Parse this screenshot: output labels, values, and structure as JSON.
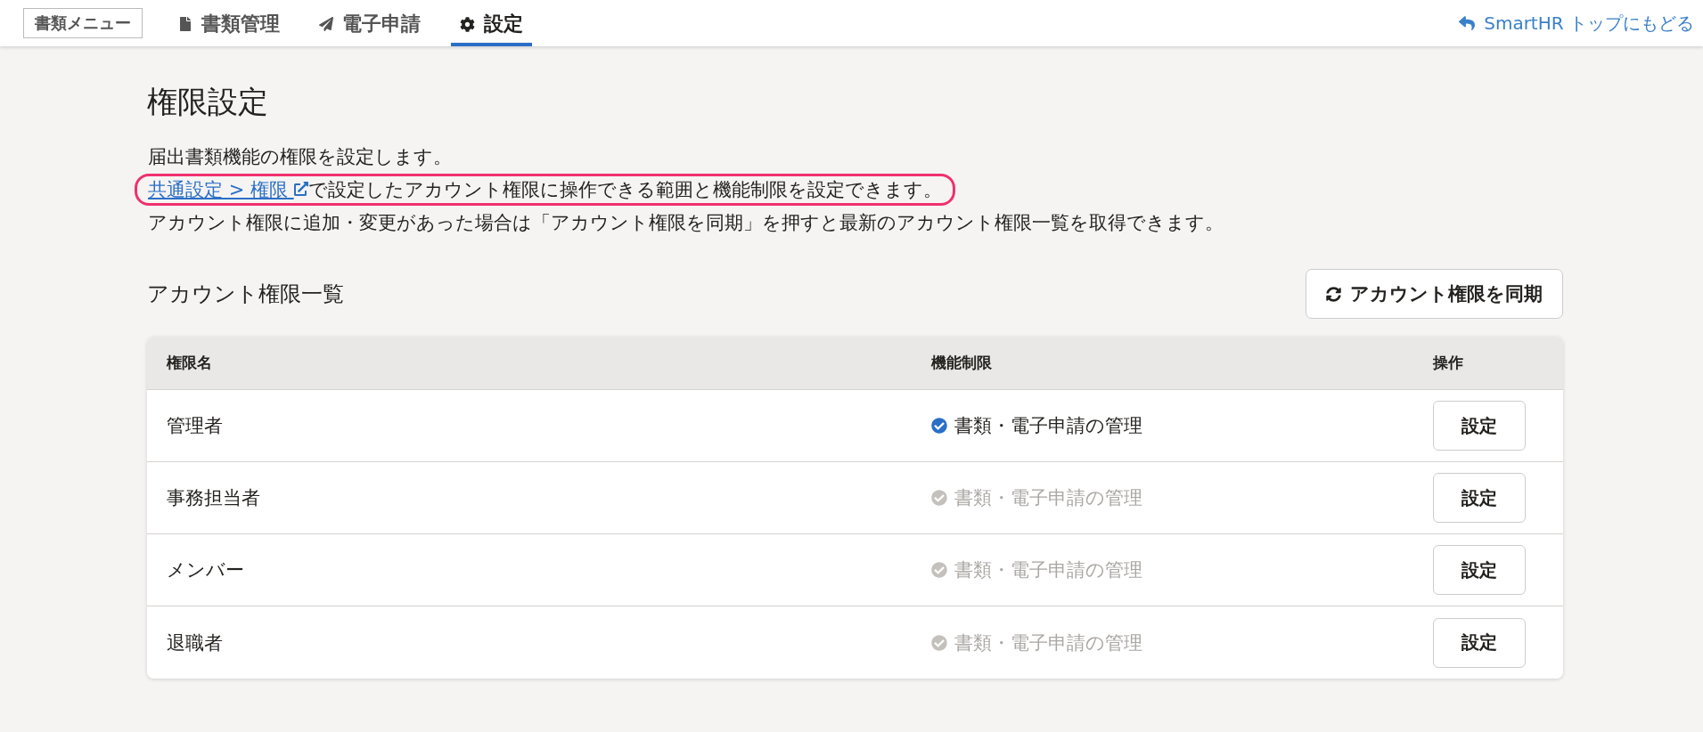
{
  "header": {
    "menu_label": "書類メニュー",
    "tabs": [
      {
        "label": "書類管理",
        "kind": "document",
        "selected": false
      },
      {
        "label": "電子申請",
        "kind": "send",
        "selected": false
      },
      {
        "label": "設定",
        "kind": "settings",
        "selected": true
      }
    ],
    "back_link": "SmartHR トップにもどる"
  },
  "page": {
    "title": "権限設定",
    "description": [
      {
        "text": "届出書類機能の権限を設定します。",
        "highlighted": false
      },
      {
        "link": "共通設定 > 権限",
        "text": "で設定したアカウント権限に操作できる範囲と機能制限を設定できます。",
        "highlighted": true
      },
      {
        "text": "アカウント権限に追加・変更があった場合は「アカウント権限を同期」を押すと最新のアカウント権限一覧を取得できます。",
        "highlighted": false
      }
    ]
  },
  "section": {
    "title": "アカウント権限一覧",
    "sync_button": "アカウント権限を同期"
  },
  "table": {
    "columns": [
      "権限名",
      "機能制限",
      "操作"
    ],
    "rows": [
      {
        "name": "管理者",
        "feature": "書類・電子申請の管理",
        "enabled": true,
        "action": "設定"
      },
      {
        "name": "事務担当者",
        "feature": "書類・電子申請の管理",
        "enabled": false,
        "action": "設定"
      },
      {
        "name": "メンバー",
        "feature": "書類・電子申請の管理",
        "enabled": false,
        "action": "設定"
      },
      {
        "name": "退職者",
        "feature": "書類・電子申請の管理",
        "enabled": false,
        "action": "設定"
      }
    ]
  }
}
